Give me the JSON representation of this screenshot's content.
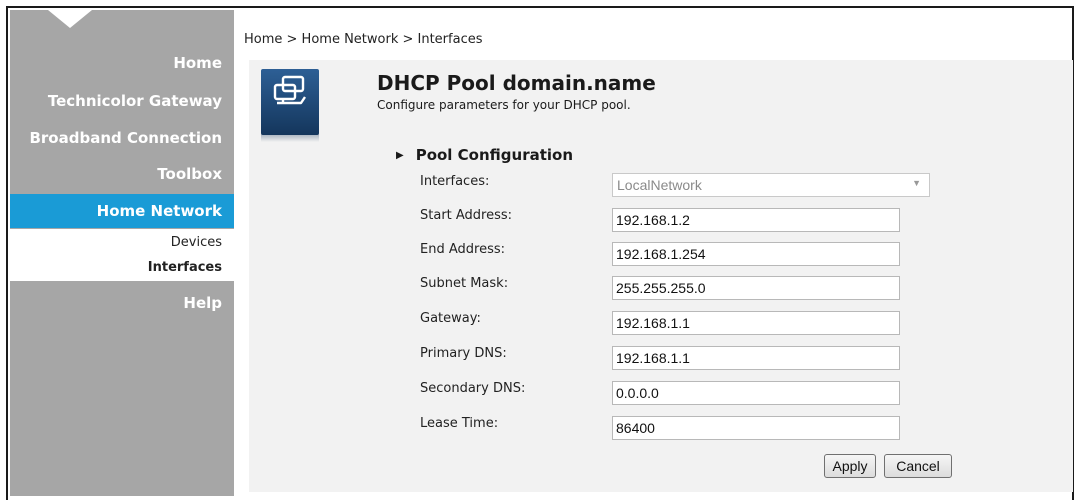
{
  "sidebar": {
    "items": [
      {
        "label": "Home"
      },
      {
        "label": "Technicolor Gateway"
      },
      {
        "label": "Broadband Connection"
      },
      {
        "label": "Toolbox"
      },
      {
        "label": "Home Network"
      },
      {
        "label": "Help"
      }
    ],
    "subitems": [
      {
        "label": "Devices"
      },
      {
        "label": "Interfaces"
      }
    ]
  },
  "breadcrumb": "Home > Home Network > Interfaces",
  "header": {
    "icon": "network-interface-icon",
    "title": "DHCP Pool domain.name",
    "subtitle": "Configure parameters for your DHCP pool."
  },
  "section": {
    "title": "Pool Configuration"
  },
  "form": {
    "interfaces": {
      "label": "Interfaces:",
      "value": "LocalNetwork"
    },
    "start_address": {
      "label": "Start Address:",
      "value": "192.168.1.2"
    },
    "end_address": {
      "label": "End Address:",
      "value": "192.168.1.254"
    },
    "subnet_mask": {
      "label": "Subnet Mask:",
      "value": "255.255.255.0"
    },
    "gateway": {
      "label": "Gateway:",
      "value": "192.168.1.1"
    },
    "primary_dns": {
      "label": "Primary DNS:",
      "value": "192.168.1.1"
    },
    "secondary_dns": {
      "label": "Secondary DNS:",
      "value": "0.0.0.0"
    },
    "lease_time": {
      "label": "Lease Time:",
      "value": "86400"
    }
  },
  "buttons": {
    "apply": "Apply",
    "cancel": "Cancel"
  },
  "colors": {
    "sidebar": "#a6a6a6",
    "active": "#1a9bd6",
    "content": "#f2f2f2",
    "icon": "#1e4a78"
  }
}
